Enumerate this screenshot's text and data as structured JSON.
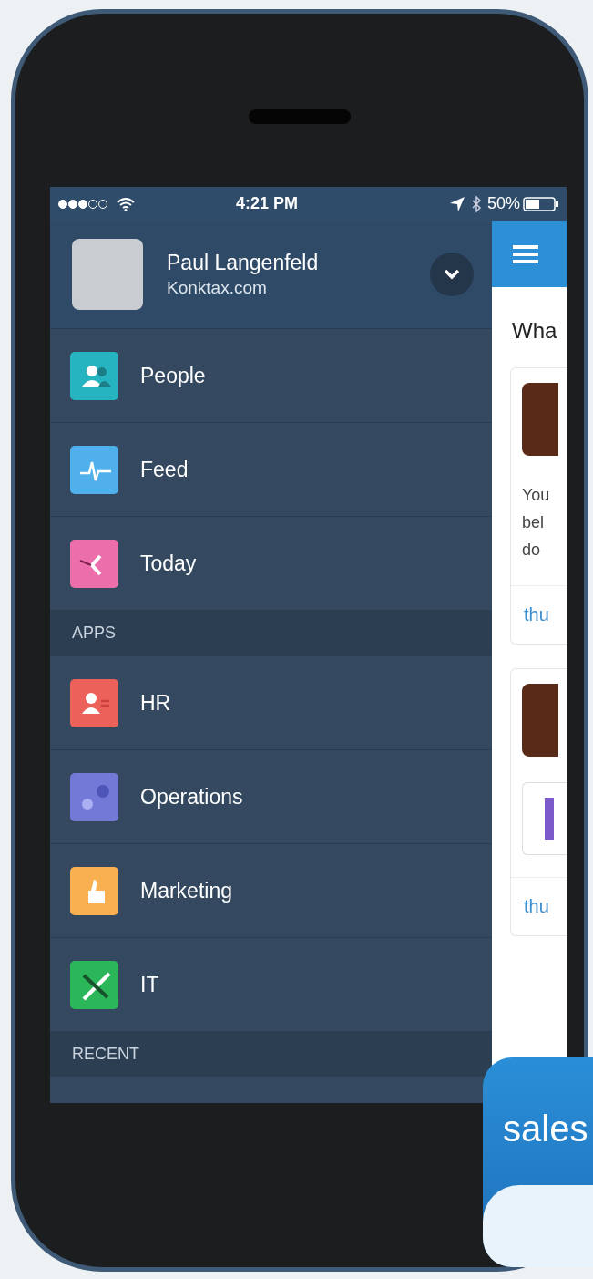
{
  "status_bar": {
    "time": "4:21 PM",
    "battery": "50%"
  },
  "profile": {
    "name": "Paul Langenfeld",
    "company": "Konktax.com"
  },
  "nav": [
    {
      "items": [
        {
          "label": "People",
          "kind": "people",
          "color": "#26b5c0"
        },
        {
          "label": "Feed",
          "kind": "pulse",
          "color": "#4fb0ec"
        },
        {
          "label": "Today",
          "kind": "clock",
          "color": "#ec6fab"
        }
      ]
    },
    {
      "header": "APPS",
      "items": [
        {
          "label": "HR",
          "kind": "contact",
          "color": "#ec625a"
        },
        {
          "label": "Operations",
          "kind": "gears",
          "color": "#7279d6"
        },
        {
          "label": "Marketing",
          "kind": "thumb",
          "color": "#f9b051"
        },
        {
          "label": "IT",
          "kind": "tools",
          "color": "#2cb65a"
        }
      ]
    },
    {
      "header": "RECENT"
    }
  ],
  "feed": {
    "heading": "Wha",
    "posts": [
      {
        "kind": "text",
        "lines": [
          "You",
          "bel",
          "do"
        ],
        "link": "thu"
      },
      {
        "kind": "attachment",
        "link": "thu"
      }
    ]
  },
  "badge": {
    "text": "sales"
  }
}
